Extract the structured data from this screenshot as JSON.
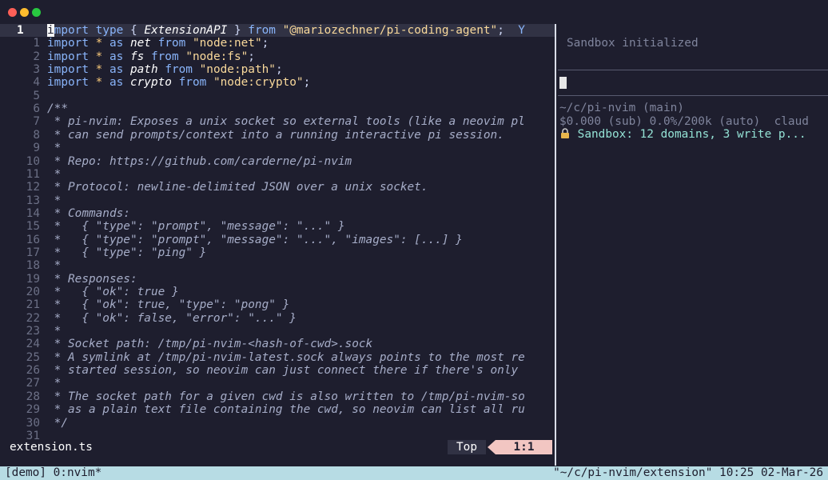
{
  "window": {
    "controls": [
      "close",
      "minimize",
      "zoom"
    ]
  },
  "editor": {
    "filename": "extension.ts",
    "scroll_label": "Top",
    "cursor_position": "1:1",
    "current_line_number": "1",
    "lines": [
      {
        "n": "1",
        "tokens": [
          [
            "cursor",
            "i"
          ],
          [
            "kw",
            "mport "
          ],
          [
            "kw",
            "type "
          ],
          [
            "plain",
            "{ "
          ],
          [
            "id",
            "ExtensionAPI"
          ],
          [
            "plain",
            " } "
          ],
          [
            "kw",
            "from "
          ],
          [
            "str",
            "\"@mariozechner/pi-coding-agent\""
          ],
          [
            "plain",
            ";  "
          ],
          [
            "kw",
            "Y"
          ]
        ]
      },
      {
        "n": "1",
        "tokens": [
          [
            "kw",
            "import "
          ],
          [
            "op",
            "* "
          ],
          [
            "kw",
            "as "
          ],
          [
            "id",
            "net "
          ],
          [
            "kw",
            "from "
          ],
          [
            "str",
            "\"node:net\""
          ],
          [
            "plain",
            ";"
          ]
        ]
      },
      {
        "n": "2",
        "tokens": [
          [
            "kw",
            "import "
          ],
          [
            "op",
            "* "
          ],
          [
            "kw",
            "as "
          ],
          [
            "id",
            "fs "
          ],
          [
            "kw",
            "from "
          ],
          [
            "str",
            "\"node:fs\""
          ],
          [
            "plain",
            ";"
          ]
        ]
      },
      {
        "n": "3",
        "tokens": [
          [
            "kw",
            "import "
          ],
          [
            "op",
            "* "
          ],
          [
            "kw",
            "as "
          ],
          [
            "id",
            "path "
          ],
          [
            "kw",
            "from "
          ],
          [
            "str",
            "\"node:path\""
          ],
          [
            "plain",
            ";"
          ]
        ]
      },
      {
        "n": "4",
        "tokens": [
          [
            "kw",
            "import "
          ],
          [
            "op",
            "* "
          ],
          [
            "kw",
            "as "
          ],
          [
            "id",
            "crypto "
          ],
          [
            "kw",
            "from "
          ],
          [
            "str",
            "\"node:crypto\""
          ],
          [
            "plain",
            ";"
          ]
        ]
      },
      {
        "n": "5",
        "tokens": []
      },
      {
        "n": "6",
        "tokens": [
          [
            "cm",
            "/**"
          ]
        ]
      },
      {
        "n": "7",
        "tokens": [
          [
            "cm",
            " * pi-nvim: Exposes a unix socket so external tools (like a neovim pl"
          ]
        ]
      },
      {
        "n": "8",
        "tokens": [
          [
            "cm",
            " * can send prompts/context into a running interactive pi session."
          ]
        ]
      },
      {
        "n": "9",
        "tokens": [
          [
            "cm",
            " *"
          ]
        ]
      },
      {
        "n": "10",
        "tokens": [
          [
            "cm",
            " * Repo: https://github.com/carderne/pi-nvim"
          ]
        ]
      },
      {
        "n": "11",
        "tokens": [
          [
            "cm",
            " *"
          ]
        ]
      },
      {
        "n": "12",
        "tokens": [
          [
            "cm",
            " * Protocol: newline-delimited JSON over a unix socket."
          ]
        ]
      },
      {
        "n": "13",
        "tokens": [
          [
            "cm",
            " *"
          ]
        ]
      },
      {
        "n": "14",
        "tokens": [
          [
            "cm",
            " * Commands:"
          ]
        ]
      },
      {
        "n": "15",
        "tokens": [
          [
            "cm",
            " *   { \"type\": \"prompt\", \"message\": \"...\" }"
          ]
        ]
      },
      {
        "n": "16",
        "tokens": [
          [
            "cm",
            " *   { \"type\": \"prompt\", \"message\": \"...\", \"images\": [...] }"
          ]
        ]
      },
      {
        "n": "17",
        "tokens": [
          [
            "cm",
            " *   { \"type\": \"ping\" }"
          ]
        ]
      },
      {
        "n": "18",
        "tokens": [
          [
            "cm",
            " *"
          ]
        ]
      },
      {
        "n": "19",
        "tokens": [
          [
            "cm",
            " * Responses:"
          ]
        ]
      },
      {
        "n": "20",
        "tokens": [
          [
            "cm",
            " *   { \"ok\": true }"
          ]
        ]
      },
      {
        "n": "21",
        "tokens": [
          [
            "cm",
            " *   { \"ok\": true, \"type\": \"pong\" }"
          ]
        ]
      },
      {
        "n": "22",
        "tokens": [
          [
            "cm",
            " *   { \"ok\": false, \"error\": \"...\" }"
          ]
        ]
      },
      {
        "n": "23",
        "tokens": [
          [
            "cm",
            " *"
          ]
        ]
      },
      {
        "n": "24",
        "tokens": [
          [
            "cm",
            " * Socket path: /tmp/pi-nvim-<hash-of-cwd>.sock"
          ]
        ]
      },
      {
        "n": "25",
        "tokens": [
          [
            "cm",
            " * A symlink at /tmp/pi-nvim-latest.sock always points to the most re"
          ]
        ]
      },
      {
        "n": "26",
        "tokens": [
          [
            "cm",
            " * started session, so neovim can just connect there if there's only"
          ]
        ]
      },
      {
        "n": "27",
        "tokens": [
          [
            "cm",
            " *"
          ]
        ]
      },
      {
        "n": "28",
        "tokens": [
          [
            "cm",
            " * The socket path for a given cwd is also written to /tmp/pi-nvim-so"
          ]
        ]
      },
      {
        "n": "29",
        "tokens": [
          [
            "cm",
            " * as a plain text file containing the cwd, so neovim can list all ru"
          ]
        ]
      },
      {
        "n": "30",
        "tokens": [
          [
            "cm",
            " */"
          ]
        ]
      },
      {
        "n": "31",
        "tokens": []
      }
    ]
  },
  "agent_pane": {
    "status_message": "Sandbox initialized",
    "cwd_line": "~/c/pi-nvim (main)",
    "usage_line": "$0.000 (sub) 0.0%/200k (auto)  claud",
    "sandbox_line": "Sandbox: 12 domains, 3 write p...",
    "lock_icon": "lock-icon"
  },
  "tmux": {
    "left": "[demo] 0:nvim*",
    "right": "\"~/c/pi-nvim/extension\" 10:25 02-Mar-26"
  },
  "colors": {
    "background": "#1e1e2e",
    "keyword": "#89b4fa",
    "string": "#f9d99b",
    "comment": "#a6adc8",
    "position_badge": "#f2c6c2",
    "tmux_bar": "#b7dce4",
    "sandbox_green": "#94e2d5"
  }
}
